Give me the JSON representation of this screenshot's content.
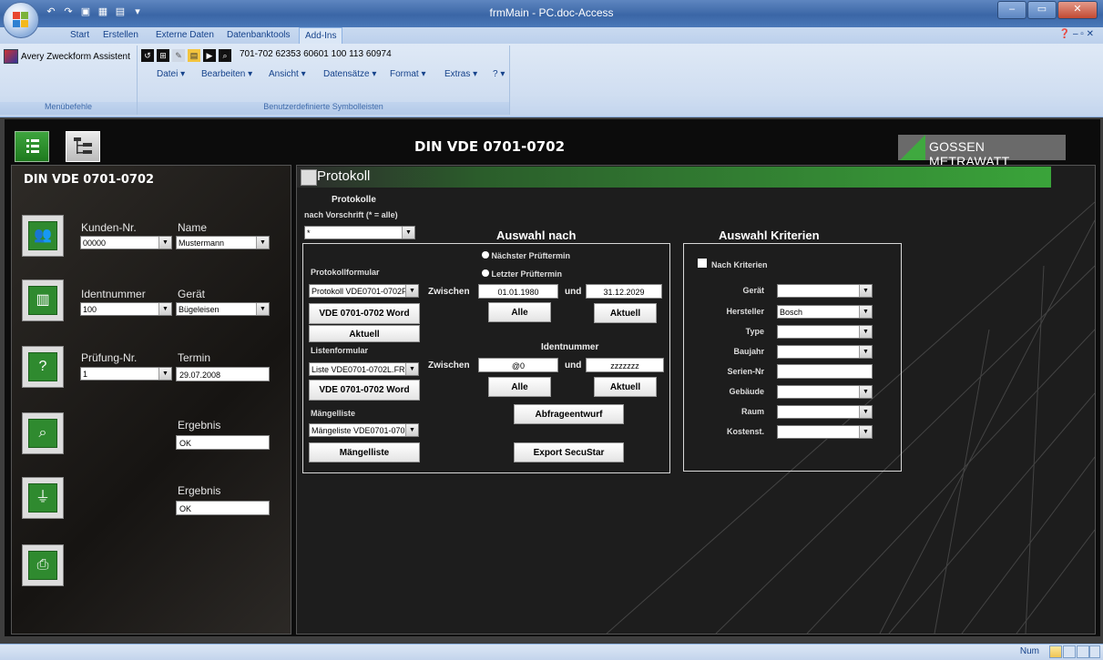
{
  "window": {
    "title": "frmMain - PC.doc-Access"
  },
  "ribbon": {
    "tabs": [
      "Start",
      "Erstellen",
      "Externe Daten",
      "Datenbanktools",
      "Add-Ins"
    ],
    "active_tab": "Add-Ins",
    "avery_label": "Avery Zweckform Assistent",
    "numbers_label": "701-702 62353 60601 100 113 60974",
    "menus": [
      "Datei",
      "Bearbeiten",
      "Ansicht",
      "Datensätze",
      "Format",
      "Extras",
      "?"
    ],
    "group1_label": "Menübefehle",
    "group2_label": "Benutzerdefinierte Symbolleisten"
  },
  "header": {
    "title": "DIN VDE 0701-0702",
    "brand": "GOSSEN METRAWATT"
  },
  "left": {
    "title": "DIN VDE 0701-0702",
    "kunden_label": "Kunden-Nr.",
    "kunden_value": "00000",
    "name_label": "Name",
    "name_value": "Mustermann",
    "ident_label": "Identnummer",
    "ident_value": "100",
    "geraet_label": "Gerät",
    "geraet_value": "Bügeleisen",
    "pruefung_label": "Prüfung-Nr.",
    "pruefung_value": "1",
    "termin_label": "Termin",
    "termin_value": "29.07.2008",
    "ergebnis1_label": "Ergebnis",
    "ergebnis1_value": "OK",
    "ergebnis2_label": "Ergebnis",
    "ergebnis2_value": "OK"
  },
  "protokoll": {
    "title": "Protokoll",
    "protokolle_label": "Protokolle",
    "vorschrift_label": "nach Vorschrift (* = alle)",
    "vorschrift_value": "*",
    "auswahl_nach": "Auswahl nach",
    "radio_next": "Nächster Prüftermin",
    "radio_last": "Letzter Prüftermin",
    "protokollformular_label": "Protokollformular",
    "protokollformular_value": "Protokoll VDE0701-0702F",
    "word_button1": "VDE 0701-0702 Word",
    "aktuell_small": "Aktuell",
    "listenformular_label": "Listenformular",
    "listenformular_value": "Liste VDE0701-0702L.FRM",
    "word_button2": "VDE 0701-0702 Word",
    "maengelliste_label": "Mängelliste",
    "maengelliste_value": "Mängeliste VDE0701-070",
    "maengelliste_button": "Mängelliste",
    "zwischen1": "Zwischen",
    "date_from": "01.01.1980",
    "und1": "und",
    "date_to": "31.12.2029",
    "alle1": "Alle",
    "aktuell1": "Aktuell",
    "identnummer_label": "Identnummer",
    "zwischen2": "Zwischen",
    "ident_from": "@0",
    "und2": "und",
    "ident_to": "zzzzzzz",
    "alle2": "Alle",
    "aktuell2": "Aktuell",
    "abfrage_button": "Abfrageentwurf",
    "export_button": "Export SecuStar"
  },
  "kriterien": {
    "title": "Auswahl Kriterien",
    "nach_kriterien": "Nach Kriterien",
    "fields": [
      {
        "label": "Gerät",
        "value": "",
        "type": "combo"
      },
      {
        "label": "Hersteller",
        "value": "Bosch",
        "type": "combo"
      },
      {
        "label": "Type",
        "value": "",
        "type": "combo"
      },
      {
        "label": "Baujahr",
        "value": "",
        "type": "combo"
      },
      {
        "label": "Serien-Nr",
        "value": "",
        "type": "text"
      },
      {
        "label": "Gebäude",
        "value": "",
        "type": "combo"
      },
      {
        "label": "Raum",
        "value": "",
        "type": "combo"
      },
      {
        "label": "Kostenst.",
        "value": "",
        "type": "combo"
      }
    ]
  },
  "status": {
    "num": "Num"
  },
  "icons": {
    "user": "users-icon",
    "barcode": "barcode-icon",
    "test": "question-icon",
    "search": "magnifier-icon",
    "plug": "plug-icon",
    "print": "printer-icon"
  },
  "colors": {
    "accent_green": "#3aa43a",
    "ribbon_blue": "#15428b"
  }
}
